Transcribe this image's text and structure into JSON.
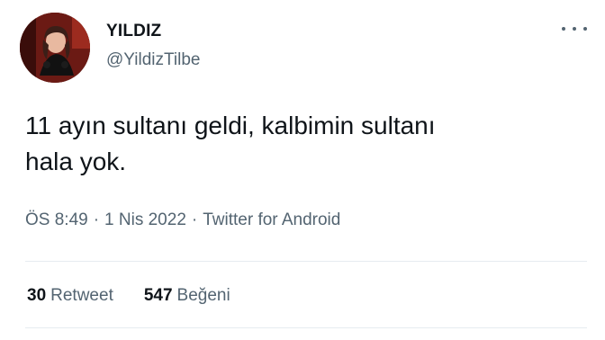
{
  "user": {
    "display_name": "YILDIZ",
    "handle": "@YildizTilbe"
  },
  "icons": {
    "more": "more-horizontal-icon"
  },
  "tweet": {
    "text": "11 ayın sultanı geldi, kalbimin sultanı\nhala yok.",
    "time": "ÖS 8:49",
    "date": "1 Nis 2022",
    "source": "Twitter for Android",
    "separator": "·"
  },
  "stats": {
    "retweets_count": "30",
    "retweets_label": "Retweet",
    "likes_count": "547",
    "likes_label": "Beğeni"
  },
  "colors": {
    "text_primary": "#0f1419",
    "text_secondary": "#536471",
    "divider": "#e6ecf0"
  }
}
